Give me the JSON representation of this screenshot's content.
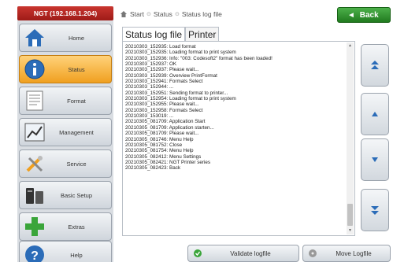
{
  "device_title": "NGT (192.168.1.204)",
  "sidebar": {
    "items": [
      {
        "label": "Home",
        "icon": "home-icon",
        "active": false
      },
      {
        "label": "Status",
        "icon": "info-icon",
        "active": true
      },
      {
        "label": "Format",
        "icon": "format-icon",
        "active": false
      },
      {
        "label": "Management",
        "icon": "management-icon",
        "active": false
      },
      {
        "label": "Service",
        "icon": "service-icon",
        "active": false
      },
      {
        "label": "Basic Setup",
        "icon": "basic-setup-icon",
        "active": false
      },
      {
        "label": "Extras",
        "icon": "extras-icon",
        "active": false
      },
      {
        "label": "Help",
        "icon": "help-icon",
        "active": false
      }
    ]
  },
  "breadcrumb": [
    "Start",
    "Status",
    "Status log file"
  ],
  "back_button": {
    "label": "Back"
  },
  "tabs": [
    {
      "label": "Status log file",
      "active": true
    },
    {
      "label": "Printer",
      "active": false
    }
  ],
  "log_lines": [
    "20210303_152935: Load format",
    "20210303_152935: Loading format to print system",
    "20210303_152936: Info: \"003: Codesoft2\" format has been loaded!",
    "20210303_152937: OK",
    "20210303_152937: Please wait...",
    "20210303_152939: Overview PrintFormat",
    "20210303_152941: Formats Select",
    "20210303_152944: ...",
    "20210303_152951: Sending format to printer...",
    "20210303_152954: Loading format to print system",
    "20210303_152955: Please wait...",
    "20210303_152958: Formats Select",
    "20210303_153019: ...",
    "20210305_081709: Application Start",
    "20210305_081709: Application starten...",
    "20210305_081709: Please wait...",
    "20210305_081746: Menu Help",
    "20210305_081752: Close",
    "20210305_081754: Menu Help",
    "20210305_082412: Menu Settings",
    "20210305_082421: NGT Printer series",
    "20210305_082423: Back"
  ],
  "scroll_buttons": [
    {
      "name": "scroll-top-button",
      "icon": "double-chevron-up-icon"
    },
    {
      "name": "scroll-up-button",
      "icon": "chevron-up-icon"
    },
    {
      "name": "scroll-down-button",
      "icon": "chevron-down-icon"
    },
    {
      "name": "scroll-bottom-button",
      "icon": "double-chevron-down-icon"
    }
  ],
  "bottom_buttons": {
    "validate": {
      "label": "Validate logfile",
      "icon": "check-icon"
    },
    "move": {
      "label": "Move Logfile",
      "icon": "disk-icon"
    }
  },
  "colors": {
    "title_bar": "#b02622",
    "active_nav": "#f0a020",
    "back_button": "#2f8f2c",
    "scroll_arrow": "#2b6cb8"
  }
}
